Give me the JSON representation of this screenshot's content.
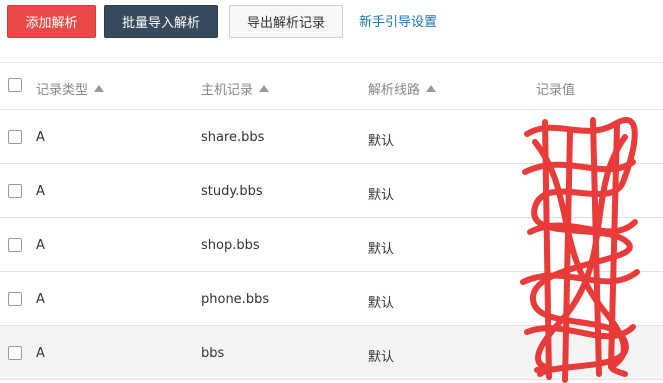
{
  "toolbar": {
    "add_label": "添加解析",
    "import_label": "批量导入解析",
    "export_label": "导出解析记录",
    "guide_label": "新手引导设置"
  },
  "table": {
    "headers": {
      "type": "记录类型",
      "host": "主机记录",
      "line": "解析线路",
      "value": "记录值"
    },
    "rows": [
      {
        "type": "A",
        "host": "share.bbs",
        "line": "默认"
      },
      {
        "type": "A",
        "host": "study.bbs",
        "line": "默认"
      },
      {
        "type": "A",
        "host": "shop.bbs",
        "line": "默认"
      },
      {
        "type": "A",
        "host": "phone.bbs",
        "line": "默认"
      },
      {
        "type": "A",
        "host": "bbs",
        "line": "默认"
      }
    ]
  },
  "colors": {
    "add_button": "#e94a47",
    "import_button": "#374a5c",
    "link": "#1f77b4",
    "redaction": "#e8312f"
  },
  "icons": [
    "sort-ascending-icon",
    "checkbox-icon"
  ]
}
